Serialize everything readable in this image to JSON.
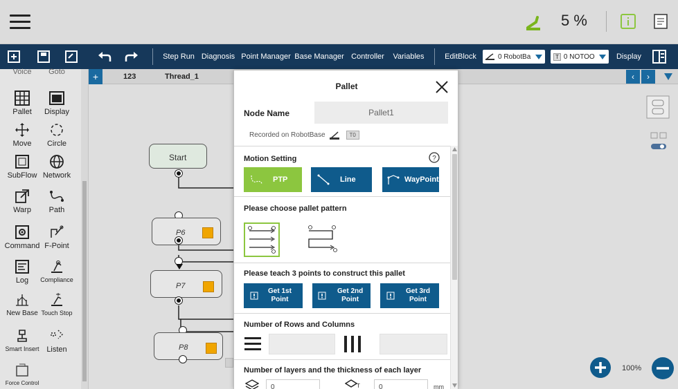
{
  "topbar": {
    "speed": "5 %",
    "menu_icon": "hamburger-icon",
    "status_icon": "robot-arm-status-icon",
    "info_icon": "info-icon",
    "doc_icon": "document-icon"
  },
  "toolbar": {
    "step_run": "Step Run",
    "diagnosis": "Diagnosis",
    "point_manager": "Point Manager",
    "base_manager": "Base Manager",
    "controller": "Controller",
    "variables": "Variables",
    "editblock": "EditBlock",
    "robot_base_select": "0 RobotBa",
    "tool_select": "0 NOTOO",
    "tool_badge": "T",
    "display": "Display"
  },
  "left_panel": {
    "items": [
      {
        "label": "Voice",
        "icon": "voice-icon"
      },
      {
        "label": "Goto",
        "icon": "goto-icon"
      },
      {
        "label": "Pallet",
        "icon": "pallet-grid-icon"
      },
      {
        "label": "Display",
        "icon": "display-icon"
      },
      {
        "label": "Move",
        "icon": "move-arrows-icon"
      },
      {
        "label": "Circle",
        "icon": "circle-icon"
      },
      {
        "label": "SubFlow",
        "icon": "subflow-icon"
      },
      {
        "label": "Network",
        "icon": "network-globe-icon"
      },
      {
        "label": "Warp",
        "icon": "warp-icon"
      },
      {
        "label": "Path",
        "icon": "path-icon"
      },
      {
        "label": "Command",
        "icon": "command-icon"
      },
      {
        "label": "F-Point",
        "icon": "f-point-icon"
      },
      {
        "label": "Log",
        "icon": "log-icon"
      },
      {
        "label": "Compliance",
        "icon": "compliance-icon"
      },
      {
        "label": "New Base",
        "icon": "new-base-icon"
      },
      {
        "label": "Touch Stop",
        "icon": "touch-stop-icon"
      },
      {
        "label": "Smart Insert",
        "icon": "smart-insert-icon"
      },
      {
        "label": "Listen",
        "icon": "listen-icon"
      },
      {
        "label": "Force Control",
        "icon": "force-control-icon"
      }
    ]
  },
  "tabs": {
    "add": "+",
    "project": "123",
    "thread": "Thread_1"
  },
  "flow": {
    "start": "Start",
    "p6": "P6",
    "p7": "P7",
    "p8": "P8"
  },
  "dialog": {
    "title": "Pallet",
    "node_name_label": "Node Name",
    "node_name_value": "Pallet1",
    "recorded_on": "Recorded on RobotBase",
    "recorded_badge": "T0",
    "motion_setting": "Motion Setting",
    "motion_buttons": [
      "PTP",
      "Line",
      "WayPoint"
    ],
    "pattern_title": "Please choose pallet pattern",
    "teach_title": "Please teach 3 points to construct this pallet",
    "teach_buttons": [
      {
        "line1": "Get 1st",
        "line2": "Point"
      },
      {
        "line1": "Get 2nd",
        "line2": "Point"
      },
      {
        "line1": "Get 3rd",
        "line2": "Point"
      }
    ],
    "rows_cols_title": "Number of Rows and Columns",
    "rows_value": "",
    "cols_value": "",
    "layers_title": "Number of layers and the thickness of each layer",
    "layers_value": "0",
    "thickness_value": "0",
    "thickness_unit": "mm",
    "thickness_badge": "T"
  },
  "zoom": {
    "level": "100%"
  },
  "colors": {
    "toolbar_bg": "#16385a",
    "ptp_green": "#8cc63f",
    "button_blue": "#0f5b8c",
    "accent_blue": "#1a6aa0"
  }
}
